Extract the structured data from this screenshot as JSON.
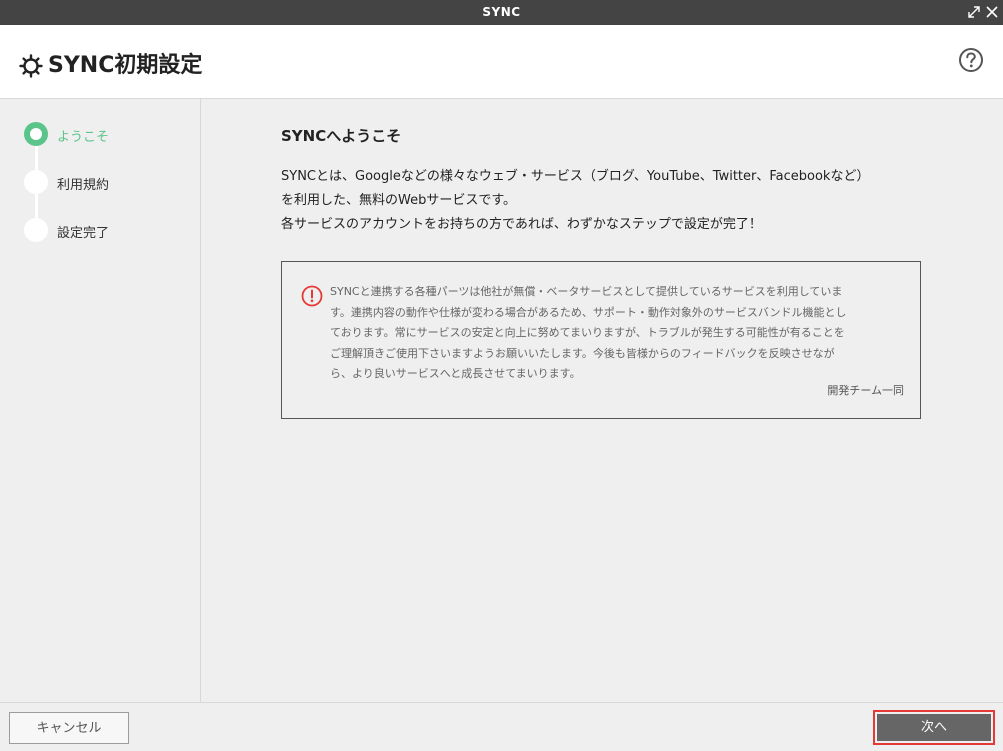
{
  "window": {
    "title": "SYNC"
  },
  "header": {
    "title": "SYNC初期設定"
  },
  "steps": [
    {
      "label": "ようこそ",
      "active": true
    },
    {
      "label": "利用規約",
      "active": false
    },
    {
      "label": "設定完了",
      "active": false
    }
  ],
  "main": {
    "title": "SYNCへようこそ",
    "intro_lines": [
      "SYNCとは、Googleなどの様々なウェブ・サービス（ブログ、YouTube、Twitter、Facebookなど）",
      "を利用した、無料のWebサービスです。",
      "各サービスのアカウントをお持ちの方であれば、わずかなステップで設定が完了！"
    ],
    "notice_lines": [
      "SYNCと連携する各種パーツは他社が無償・ベータサービスとして提供しているサービスを利用していま",
      "す。連携内容の動作や仕様が変わる場合があるため、サポート・動作対象外のサービスバンドル機能とし",
      "ております。常にサービスの安定と向上に努めてまいりますが、トラブルが発生する可能性が有ることを",
      "ご理解頂きご使用下さいますようお願いいたします。今後も皆様からのフィードバックを反映させなが",
      "ら、より良いサービスへと成長させてまいります。"
    ],
    "signature": "開発チーム一同"
  },
  "footer": {
    "cancel_label": "キャンセル",
    "next_label": "次へ"
  },
  "colors": {
    "accent_green": "#5ac48a",
    "highlight_red": "#e53935",
    "titlebar": "#444444"
  },
  "icons": {
    "title": "gear-icon",
    "help": "help-circle-icon",
    "warning": "warning-circle-icon",
    "maximize": "maximize-icon",
    "close": "close-icon"
  }
}
